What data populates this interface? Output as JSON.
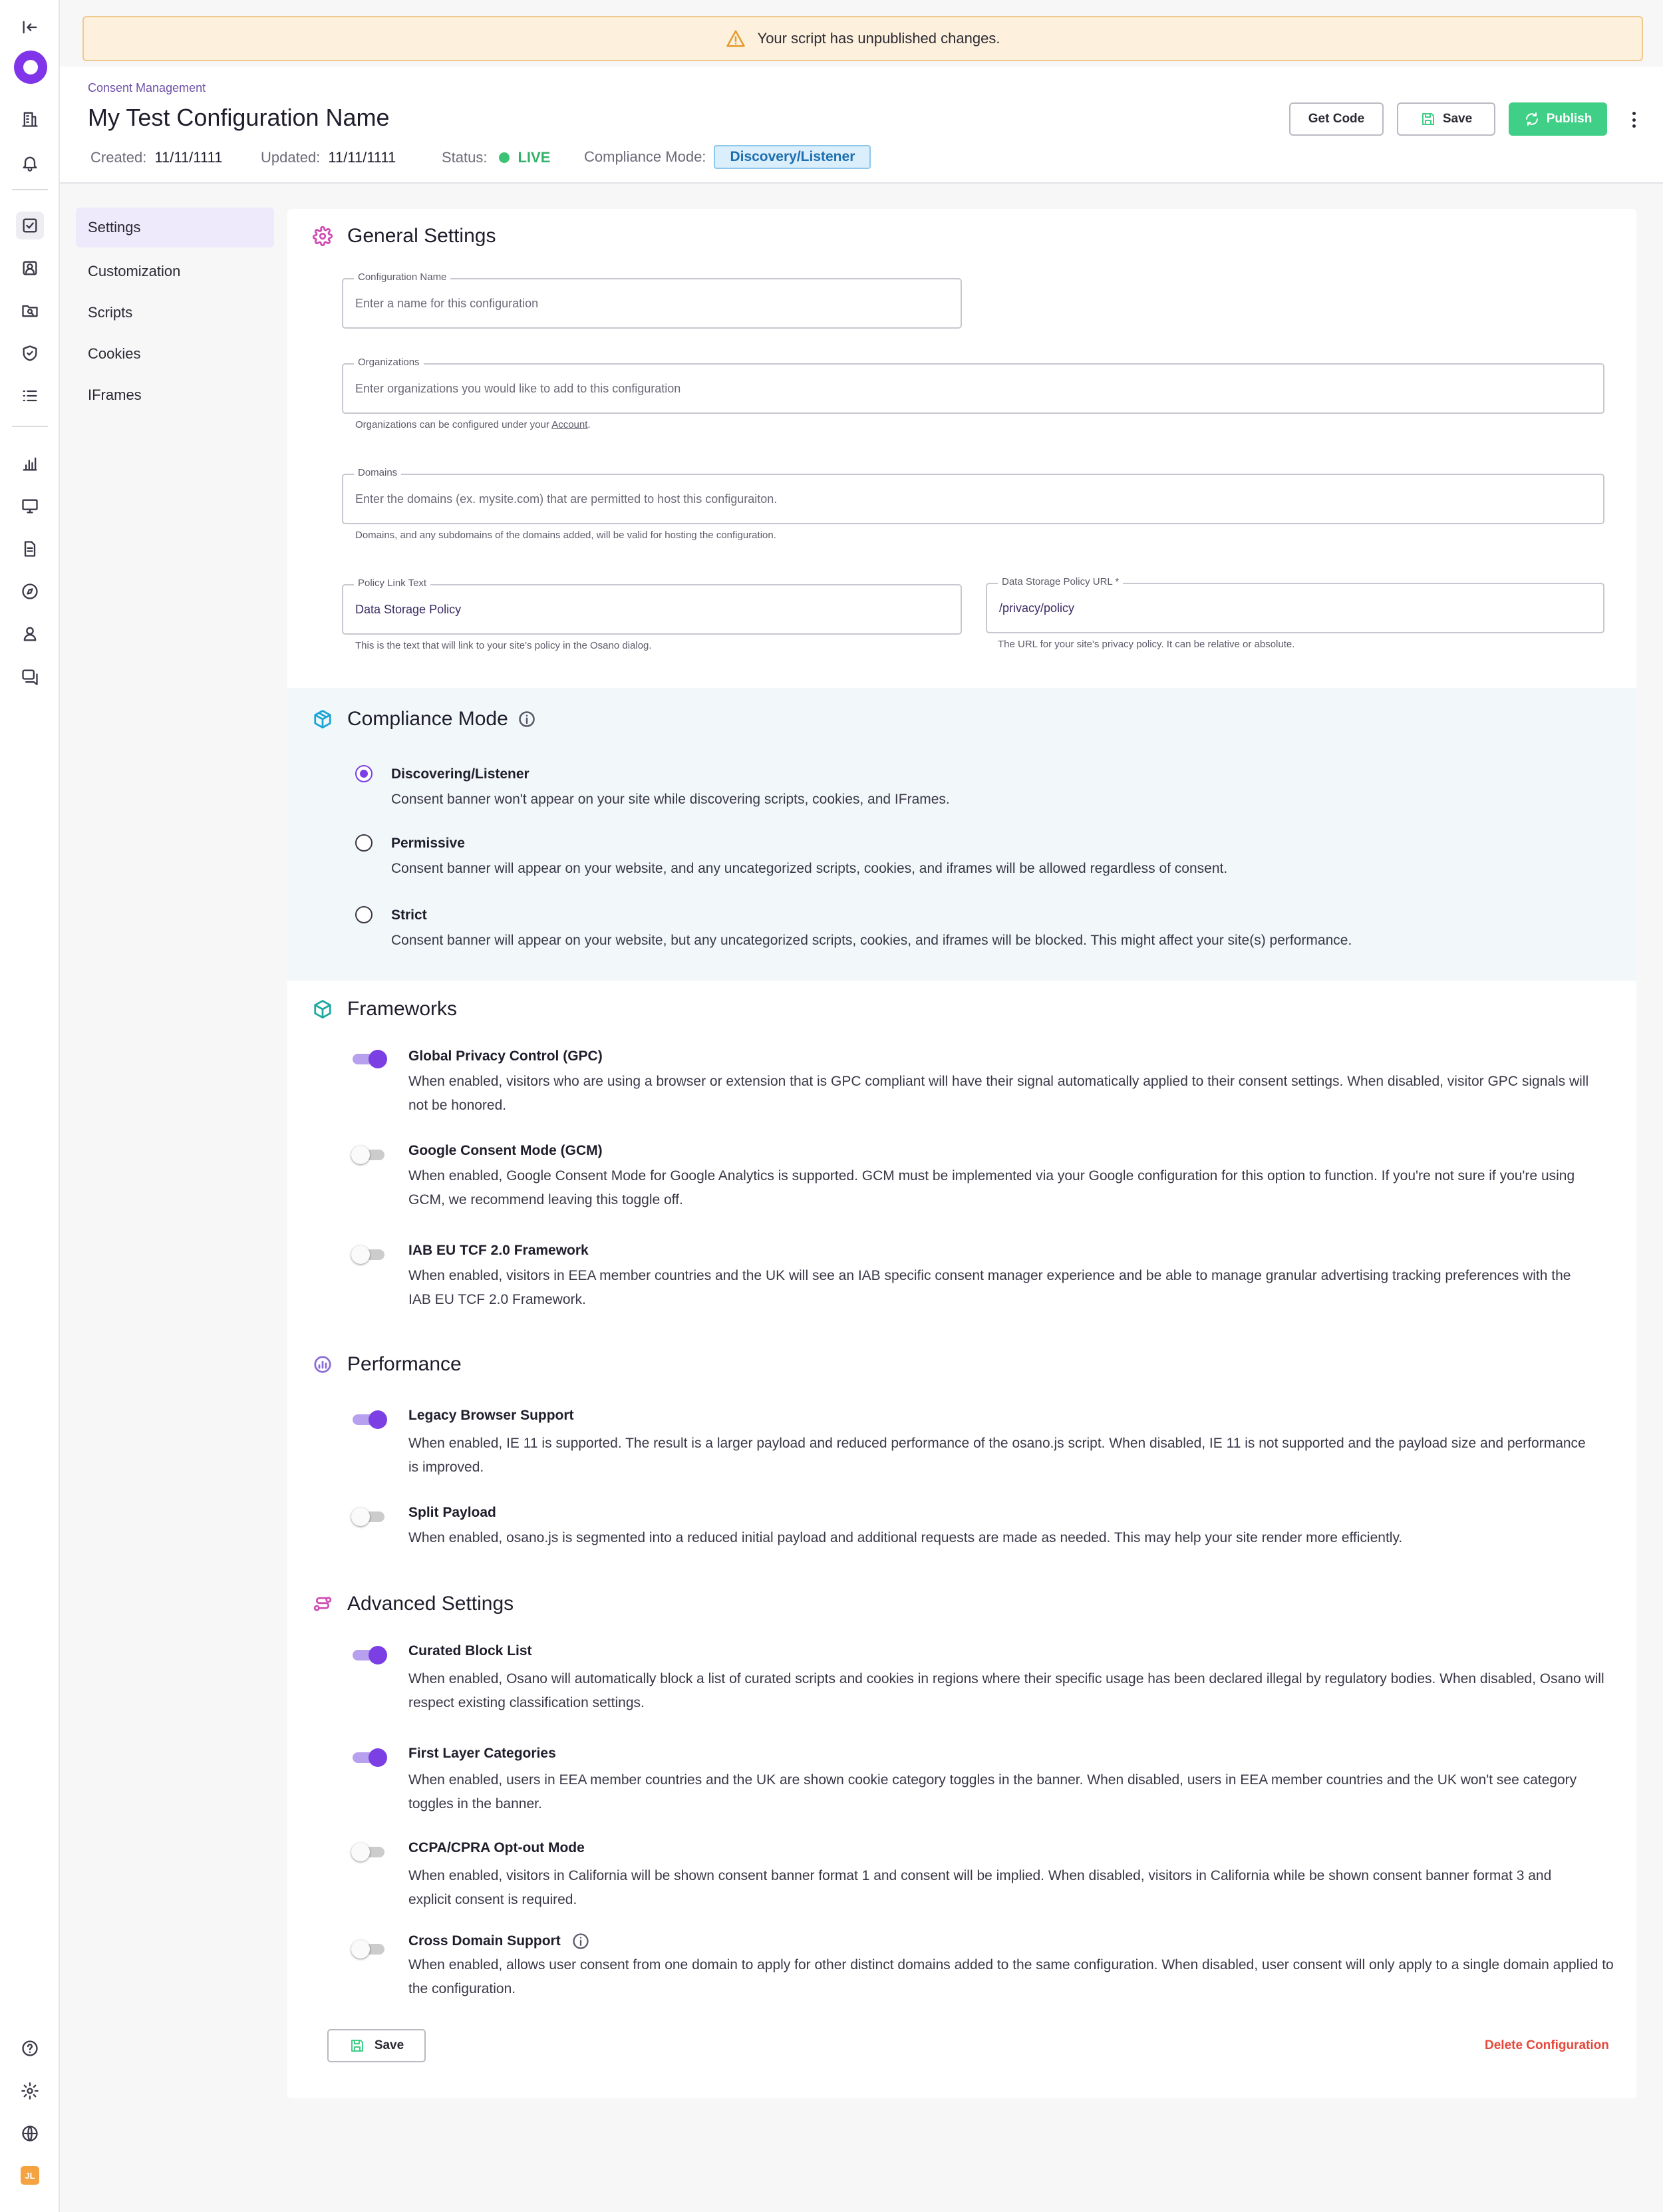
{
  "alert": {
    "text": "Your script has unpublished changes."
  },
  "header": {
    "breadcrumb": "Consent Management",
    "title": "My Test Configuration Name",
    "created_label": "Created:",
    "created_value": "11/11/1111",
    "updated_label": "Updated:",
    "updated_value": "11/11/1111",
    "status_label": "Status:",
    "status_value": "LIVE",
    "mode_label": "Compliance Mode:",
    "mode_value": "Discovery/Listener",
    "get_code": "Get Code",
    "save": "Save",
    "publish": "Publish"
  },
  "nav": {
    "items": [
      {
        "label": "Settings",
        "active": true
      },
      {
        "label": "Customization"
      },
      {
        "label": "Scripts"
      },
      {
        "label": "Cookies"
      },
      {
        "label": "IFrames"
      }
    ]
  },
  "general": {
    "title": "General Settings",
    "config_name": {
      "label": "Configuration Name",
      "placeholder": "Enter a name for this configuration"
    },
    "organizations": {
      "label": "Organizations",
      "placeholder": "Enter organizations you would like to add to this configuration",
      "help_pre": "Organizations can be configured under your ",
      "help_link": "Account",
      "help_post": "."
    },
    "domains": {
      "label": "Domains",
      "placeholder": "Enter the domains (ex. mysite.com) that are permitted to host this configuraiton.",
      "help": "Domains, and any subdomains of the domains added, will be valid for hosting the configuration."
    },
    "policy_text": {
      "label": "Policy Link Text",
      "value": "Data Storage Policy",
      "help": "This is the text that will link to your site's policy in the Osano dialog."
    },
    "policy_url": {
      "label": "Data Storage Policy URL *",
      "value": "/privacy/policy",
      "help": "The URL for your site's privacy policy. It can be relative or absolute."
    }
  },
  "compliance": {
    "title": "Compliance Mode",
    "options": [
      {
        "title": "Discovering/Listener",
        "desc": "Consent banner won't appear on your site while discovering scripts, cookies, and IFrames.",
        "selected": true
      },
      {
        "title": "Permissive",
        "desc": "Consent banner will appear on your website, and any uncategorized scripts, cookies, and iframes will be allowed regardless of consent."
      },
      {
        "title": "Strict",
        "desc": "Consent banner will appear on your website, but any uncategorized scripts, cookies, and iframes will be blocked. This might affect your site(s) performance."
      }
    ]
  },
  "frameworks": {
    "title": "Frameworks",
    "items": [
      {
        "title": "Global Privacy Control (GPC)",
        "on": true,
        "desc": "When enabled, visitors who are using a browser or extension that is GPC compliant will have their signal automatically applied to their consent settings. When disabled, visitor GPC signals will not be honored."
      },
      {
        "title": "Google Consent Mode (GCM)",
        "on": false,
        "desc": "When enabled, Google Consent Mode for Google Analytics is supported. GCM must be implemented via your Google configuration for this option to function. If you're not sure if you're using GCM, we recommend leaving this toggle off."
      },
      {
        "title": "IAB EU TCF 2.0 Framework",
        "on": false,
        "desc": "When enabled, visitors in EEA member countries and the UK will see an IAB specific consent manager experience and be able to manage granular advertising tracking preferences with the IAB EU TCF 2.0 Framework."
      }
    ]
  },
  "performance": {
    "title": "Performance",
    "items": [
      {
        "title": "Legacy Browser Support",
        "on": true,
        "desc": "When enabled, IE 11 is supported. The result is a larger payload and reduced performance of the osano.js script. When disabled, IE 11 is not supported and the payload size and performance is improved."
      },
      {
        "title": "Split Payload",
        "on": false,
        "desc": "When enabled, osano.js is segmented into a reduced initial payload and additional requests are made as needed. This may help your site render more efficiently."
      }
    ]
  },
  "advanced": {
    "title": "Advanced Settings",
    "items": [
      {
        "title": "Curated Block List",
        "on": true,
        "desc": "When enabled, Osano will automatically block a list of curated scripts and cookies in regions where their specific usage has been declared illegal by regulatory bodies. When disabled, Osano will respect existing classification settings."
      },
      {
        "title": "First Layer Categories",
        "on": true,
        "desc": "When enabled, users in EEA member countries and the UK are shown cookie category toggles in the banner. When disabled, users in EEA member countries and the UK won't see category toggles in the banner."
      },
      {
        "title": "CCPA/CPRA Opt-out Mode",
        "on": false,
        "desc": "When enabled, visitors in California will be shown consent banner format 1 and consent will be implied. When disabled, visitors in California while be shown consent banner format 3 and explicit consent is required."
      },
      {
        "title": "Cross Domain Support",
        "on": false,
        "desc": "When enabled, allows user consent from one domain to apply for other distinct domains added to the same configuration. When disabled, user consent will only apply to a single domain applied to the configuration."
      }
    ]
  },
  "footer": {
    "save": "Save",
    "delete": "Delete Configuration"
  },
  "user": {
    "initials": "JL"
  },
  "colors": {
    "accent": "#7b3fe4",
    "publish": "#3fcf86",
    "danger": "#e5483b",
    "live": "#3bc273",
    "warning_bg": "#fdf0dc"
  }
}
